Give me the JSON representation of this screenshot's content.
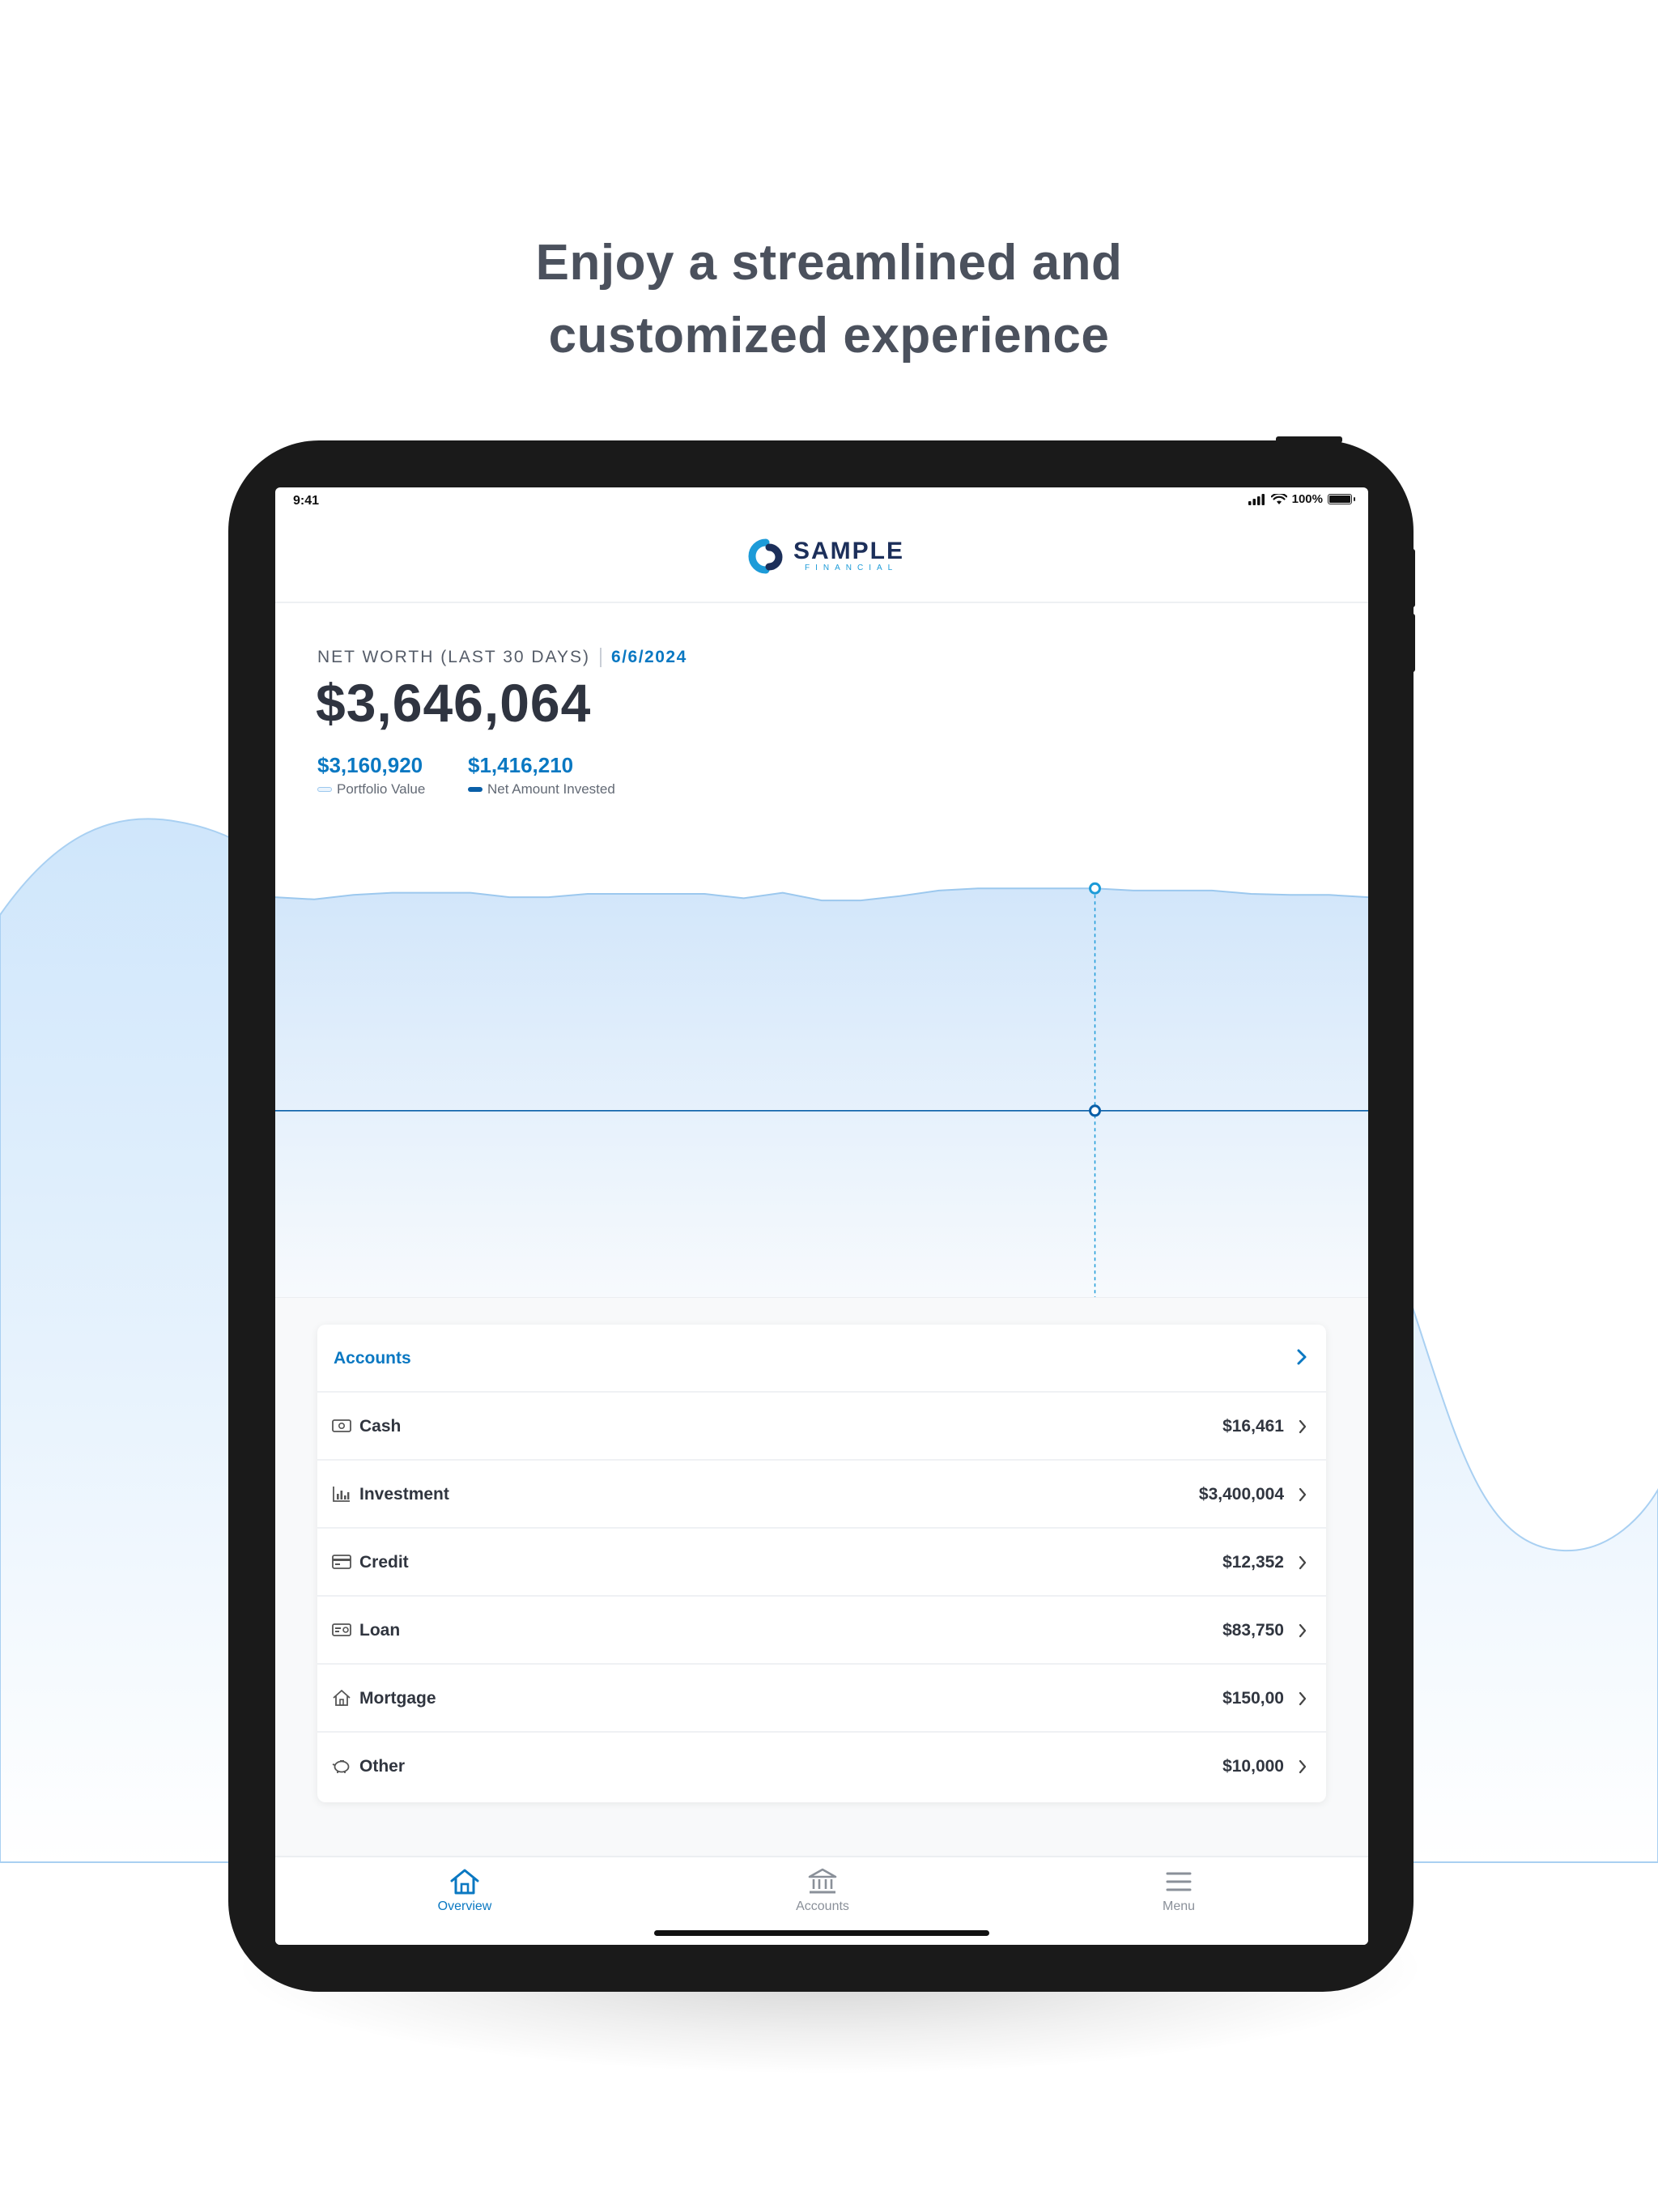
{
  "headline": {
    "line1": "Enjoy a streamlined and",
    "line2": "customized experience"
  },
  "status_bar": {
    "time": "9:41",
    "battery_text": "100%",
    "battery_level": 1.0
  },
  "logo": {
    "main": "SAMPLE",
    "sub": "FINANCIAL"
  },
  "net_worth": {
    "label": "NET WORTH (LAST 30 DAYS)",
    "date": "6/6/2024",
    "value": "$3,646,064",
    "portfolio_value": "$3,160,920",
    "portfolio_label": "Portfolio Value",
    "net_invested_value": "$1,416,210",
    "net_invested_label": "Net Amount Invested"
  },
  "chart_data": {
    "type": "area",
    "title": "",
    "xlabel": "",
    "ylabel": "",
    "ylim": [
      0,
      3800000
    ],
    "grid": false,
    "selected_index": 21,
    "series": [
      {
        "name": "Portfolio Value",
        "color": "#9cc8ee",
        "fill": "#d4e8fb",
        "values": [
          3370000,
          3350000,
          3390000,
          3410000,
          3410000,
          3410000,
          3370000,
          3370000,
          3400000,
          3400000,
          3400000,
          3400000,
          3360000,
          3410000,
          3340000,
          3340000,
          3380000,
          3430000,
          3450000,
          3450000,
          3450000,
          3450000,
          3430000,
          3430000,
          3430000,
          3400000,
          3390000,
          3390000,
          3370000
        ]
      },
      {
        "name": "Net Amount Invested",
        "color": "#0a5fa8",
        "values": [
          1416210,
          1416210,
          1416210,
          1416210,
          1416210,
          1416210,
          1416210,
          1416210,
          1416210,
          1416210,
          1416210,
          1416210,
          1416210,
          1416210,
          1416210,
          1416210,
          1416210,
          1416210,
          1416210,
          1416210,
          1416210,
          1416210,
          1416210,
          1416210,
          1416210,
          1416210,
          1416210,
          1416210,
          1416210
        ]
      }
    ]
  },
  "accounts": {
    "title": "Accounts",
    "rows": [
      {
        "name": "Cash",
        "value": "$16,461",
        "icon": "cash-icon"
      },
      {
        "name": "Investment",
        "value": "$3,400,004",
        "icon": "investment-chart-icon"
      },
      {
        "name": "Credit",
        "value": "$12,352",
        "icon": "credit-card-icon"
      },
      {
        "name": "Loan",
        "value": "$83,750",
        "icon": "loan-icon"
      },
      {
        "name": "Mortgage",
        "value": "$150,00",
        "icon": "house-icon"
      },
      {
        "name": "Other",
        "value": "$10,000",
        "icon": "piggy-bank-icon"
      }
    ]
  },
  "tab_bar": {
    "tabs": [
      {
        "label": "Overview",
        "icon": "home-icon",
        "active": true
      },
      {
        "label": "Accounts",
        "icon": "bank-icon",
        "active": false
      },
      {
        "label": "Menu",
        "icon": "hamburger-menu-icon",
        "active": false
      }
    ]
  },
  "colors": {
    "accent": "#0a78c2",
    "text_dark": "#2f3440",
    "headline": "#4b515d",
    "device": "#1a1a1a",
    "wave_light": "#cfe6fb"
  }
}
